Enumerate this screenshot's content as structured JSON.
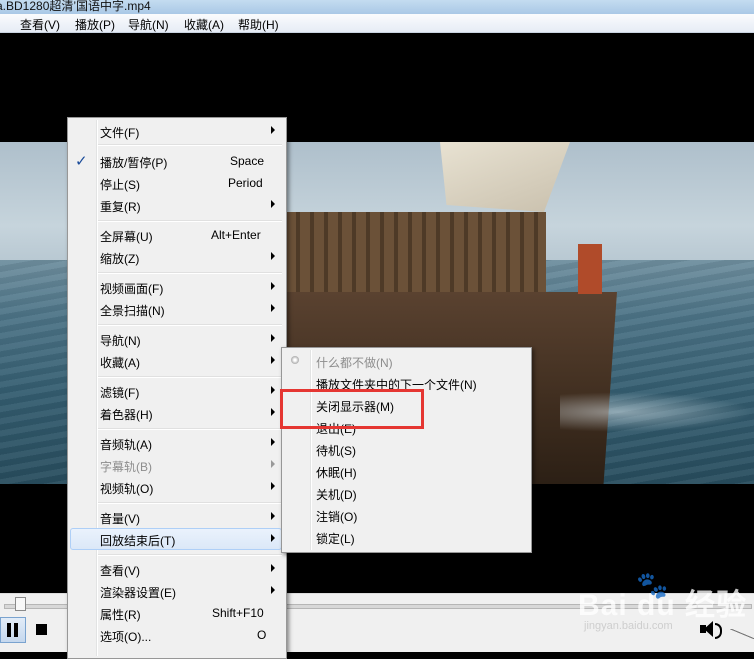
{
  "window": {
    "title": "a.BD1280超清’国语中字.mp4"
  },
  "menubar": [
    "查看(V)",
    "播放(P)",
    "导航(N)",
    "收藏(A)",
    "帮助(H)"
  ],
  "context_menu": {
    "items": [
      {
        "label": "文件(F)",
        "submenu": true
      },
      {
        "label": "播放/暂停(P)",
        "shortcut": "Space",
        "checked": true
      },
      {
        "label": "停止(S)",
        "shortcut": "Period"
      },
      {
        "label": "重复(R)",
        "submenu": true
      },
      {
        "label": "全屏幕(U)",
        "shortcut": "Alt+Enter"
      },
      {
        "label": "缩放(Z)",
        "submenu": true
      },
      {
        "label": "视频画面(F)",
        "submenu": true
      },
      {
        "label": "全景扫描(N)",
        "submenu": true
      },
      {
        "label": "导航(N)",
        "submenu": true
      },
      {
        "label": "收藏(A)",
        "submenu": true
      },
      {
        "label": "滤镜(F)",
        "submenu": true
      },
      {
        "label": "着色器(H)",
        "submenu": true
      },
      {
        "label": "音频轨(A)",
        "submenu": true
      },
      {
        "label": "字幕轨(B)",
        "submenu": true,
        "disabled": true
      },
      {
        "label": "视频轨(O)",
        "submenu": true
      },
      {
        "label": "音量(V)",
        "submenu": true
      },
      {
        "label": "回放结束后(T)",
        "submenu": true,
        "highlighted": true
      },
      {
        "label": "查看(V)",
        "submenu": true
      },
      {
        "label": "渲染器设置(E)",
        "submenu": true
      },
      {
        "label": "属性(R)",
        "shortcut": "Shift+F10"
      },
      {
        "label": "选项(O)...",
        "shortcut": "O"
      }
    ]
  },
  "submenu": {
    "items": [
      {
        "label": "什么都不做(N)",
        "selected": true,
        "disabled": true
      },
      {
        "label": "播放文件夹中的下一个文件(N)"
      },
      {
        "label": "关闭显示器(M)",
        "annotated": true
      },
      {
        "label": "退出(E)"
      },
      {
        "label": "待机(S)"
      },
      {
        "label": "休眠(H)"
      },
      {
        "label": "关机(D)"
      },
      {
        "label": "注销(O)"
      },
      {
        "label": "锁定(L)"
      }
    ]
  },
  "controls": {
    "pause": "pause-icon",
    "stop": "stop-icon",
    "volume": "speaker-icon"
  },
  "watermark": {
    "brand": "Bai du 经验",
    "url": "jingyan.baidu.com"
  },
  "colors": {
    "annotation": "#e53632",
    "highlight": "#dbe8f8",
    "menu_bg": "#f0f0f0"
  }
}
